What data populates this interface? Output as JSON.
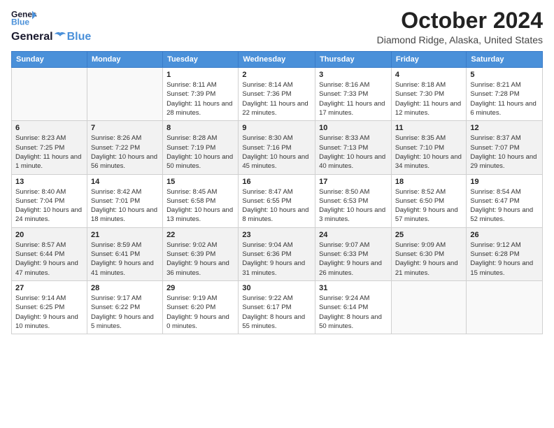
{
  "header": {
    "logo_line1": "General",
    "logo_line2": "Blue",
    "title": "October 2024",
    "subtitle": "Diamond Ridge, Alaska, United States"
  },
  "weekdays": [
    "Sunday",
    "Monday",
    "Tuesday",
    "Wednesday",
    "Thursday",
    "Friday",
    "Saturday"
  ],
  "weeks": [
    [
      {
        "day": "",
        "info": ""
      },
      {
        "day": "",
        "info": ""
      },
      {
        "day": "1",
        "info": "Sunrise: 8:11 AM\nSunset: 7:39 PM\nDaylight: 11 hours and 28 minutes."
      },
      {
        "day": "2",
        "info": "Sunrise: 8:14 AM\nSunset: 7:36 PM\nDaylight: 11 hours and 22 minutes."
      },
      {
        "day": "3",
        "info": "Sunrise: 8:16 AM\nSunset: 7:33 PM\nDaylight: 11 hours and 17 minutes."
      },
      {
        "day": "4",
        "info": "Sunrise: 8:18 AM\nSunset: 7:30 PM\nDaylight: 11 hours and 12 minutes."
      },
      {
        "day": "5",
        "info": "Sunrise: 8:21 AM\nSunset: 7:28 PM\nDaylight: 11 hours and 6 minutes."
      }
    ],
    [
      {
        "day": "6",
        "info": "Sunrise: 8:23 AM\nSunset: 7:25 PM\nDaylight: 11 hours and 1 minute."
      },
      {
        "day": "7",
        "info": "Sunrise: 8:26 AM\nSunset: 7:22 PM\nDaylight: 10 hours and 56 minutes."
      },
      {
        "day": "8",
        "info": "Sunrise: 8:28 AM\nSunset: 7:19 PM\nDaylight: 10 hours and 50 minutes."
      },
      {
        "day": "9",
        "info": "Sunrise: 8:30 AM\nSunset: 7:16 PM\nDaylight: 10 hours and 45 minutes."
      },
      {
        "day": "10",
        "info": "Sunrise: 8:33 AM\nSunset: 7:13 PM\nDaylight: 10 hours and 40 minutes."
      },
      {
        "day": "11",
        "info": "Sunrise: 8:35 AM\nSunset: 7:10 PM\nDaylight: 10 hours and 34 minutes."
      },
      {
        "day": "12",
        "info": "Sunrise: 8:37 AM\nSunset: 7:07 PM\nDaylight: 10 hours and 29 minutes."
      }
    ],
    [
      {
        "day": "13",
        "info": "Sunrise: 8:40 AM\nSunset: 7:04 PM\nDaylight: 10 hours and 24 minutes."
      },
      {
        "day": "14",
        "info": "Sunrise: 8:42 AM\nSunset: 7:01 PM\nDaylight: 10 hours and 18 minutes."
      },
      {
        "day": "15",
        "info": "Sunrise: 8:45 AM\nSunset: 6:58 PM\nDaylight: 10 hours and 13 minutes."
      },
      {
        "day": "16",
        "info": "Sunrise: 8:47 AM\nSunset: 6:55 PM\nDaylight: 10 hours and 8 minutes."
      },
      {
        "day": "17",
        "info": "Sunrise: 8:50 AM\nSunset: 6:53 PM\nDaylight: 10 hours and 3 minutes."
      },
      {
        "day": "18",
        "info": "Sunrise: 8:52 AM\nSunset: 6:50 PM\nDaylight: 9 hours and 57 minutes."
      },
      {
        "day": "19",
        "info": "Sunrise: 8:54 AM\nSunset: 6:47 PM\nDaylight: 9 hours and 52 minutes."
      }
    ],
    [
      {
        "day": "20",
        "info": "Sunrise: 8:57 AM\nSunset: 6:44 PM\nDaylight: 9 hours and 47 minutes."
      },
      {
        "day": "21",
        "info": "Sunrise: 8:59 AM\nSunset: 6:41 PM\nDaylight: 9 hours and 41 minutes."
      },
      {
        "day": "22",
        "info": "Sunrise: 9:02 AM\nSunset: 6:39 PM\nDaylight: 9 hours and 36 minutes."
      },
      {
        "day": "23",
        "info": "Sunrise: 9:04 AM\nSunset: 6:36 PM\nDaylight: 9 hours and 31 minutes."
      },
      {
        "day": "24",
        "info": "Sunrise: 9:07 AM\nSunset: 6:33 PM\nDaylight: 9 hours and 26 minutes."
      },
      {
        "day": "25",
        "info": "Sunrise: 9:09 AM\nSunset: 6:30 PM\nDaylight: 9 hours and 21 minutes."
      },
      {
        "day": "26",
        "info": "Sunrise: 9:12 AM\nSunset: 6:28 PM\nDaylight: 9 hours and 15 minutes."
      }
    ],
    [
      {
        "day": "27",
        "info": "Sunrise: 9:14 AM\nSunset: 6:25 PM\nDaylight: 9 hours and 10 minutes."
      },
      {
        "day": "28",
        "info": "Sunrise: 9:17 AM\nSunset: 6:22 PM\nDaylight: 9 hours and 5 minutes."
      },
      {
        "day": "29",
        "info": "Sunrise: 9:19 AM\nSunset: 6:20 PM\nDaylight: 9 hours and 0 minutes."
      },
      {
        "day": "30",
        "info": "Sunrise: 9:22 AM\nSunset: 6:17 PM\nDaylight: 8 hours and 55 minutes."
      },
      {
        "day": "31",
        "info": "Sunrise: 9:24 AM\nSunset: 6:14 PM\nDaylight: 8 hours and 50 minutes."
      },
      {
        "day": "",
        "info": ""
      },
      {
        "day": "",
        "info": ""
      }
    ]
  ],
  "colors": {
    "header_bg": "#4a90d9",
    "header_text": "#ffffff",
    "odd_row_bg": "#f5f5f5",
    "even_row_bg": "#ffffff"
  }
}
